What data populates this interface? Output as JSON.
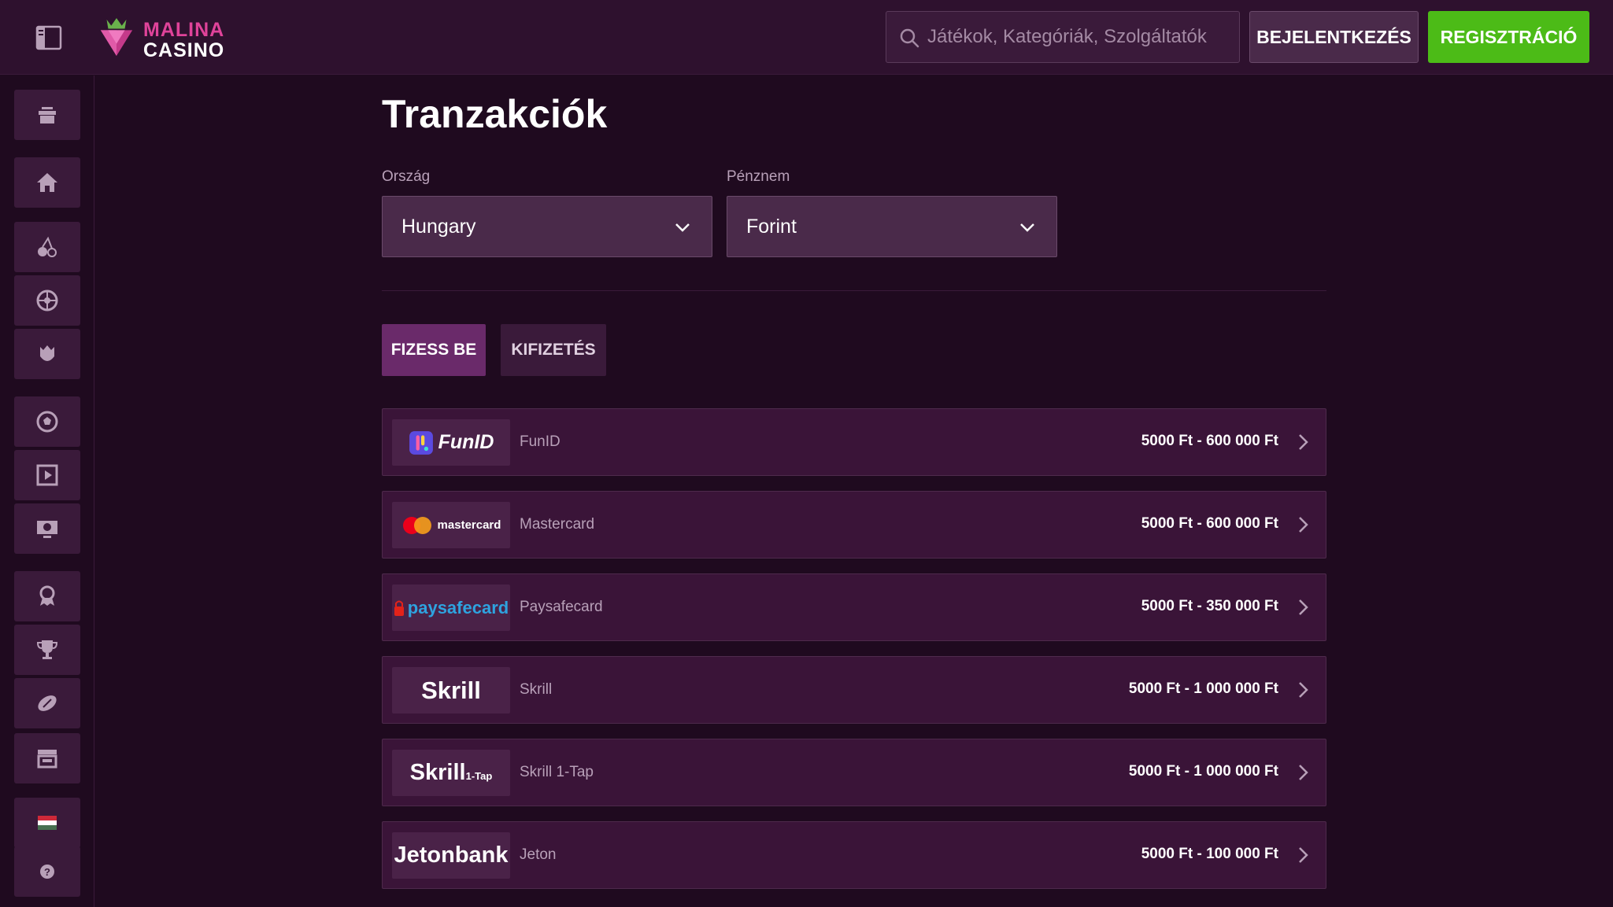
{
  "header": {
    "logo_line1": "MALINA",
    "logo_line2": "CASINO",
    "search_placeholder": "Játékok, Kategóriák, Szolgáltatók",
    "login_label": "BEJELENTKEZÉS",
    "register_label": "REGISZTRÁCIÓ"
  },
  "sidebar": {
    "items": [
      {
        "icon": "gift-icon"
      },
      {
        "icon": "home-icon"
      },
      {
        "icon": "cherries-icon"
      },
      {
        "icon": "roulette-icon"
      },
      {
        "icon": "hands-icon"
      },
      {
        "icon": "soccer-ball-icon"
      },
      {
        "icon": "video-play-icon"
      },
      {
        "icon": "tv-icon"
      },
      {
        "icon": "award-icon"
      },
      {
        "icon": "trophy-icon"
      },
      {
        "icon": "rugby-icon"
      },
      {
        "icon": "shop-icon"
      },
      {
        "icon": "hungary-flag-icon"
      },
      {
        "icon": "help-icon"
      }
    ]
  },
  "main": {
    "title": "Tranzakciók",
    "country": {
      "label": "Ország",
      "value": "Hungary"
    },
    "currency": {
      "label": "Pénznem",
      "value": "Forint"
    },
    "tabs": [
      {
        "label": "FIZESS BE",
        "active": true
      },
      {
        "label": "KIFIZETÉS",
        "active": false
      }
    ],
    "methods": [
      {
        "logo_text": "FunID",
        "name": "FunID",
        "range": "5000 Ft - 600 000 Ft"
      },
      {
        "logo_text": "mastercard",
        "name": "Mastercard",
        "range": "5000 Ft - 600 000 Ft"
      },
      {
        "logo_text": "paysafecard",
        "name": "Paysafecard",
        "range": "5000 Ft - 350 000 Ft"
      },
      {
        "logo_text": "Skrill",
        "name": "Skrill",
        "range": "5000 Ft - 1 000 000 Ft"
      },
      {
        "logo_text": "Skrill",
        "logo_sub": "1-Tap",
        "name": "Skrill 1-Tap",
        "range": "5000 Ft - 1 000 000 Ft"
      },
      {
        "logo_text": "Jetonbank",
        "name": "Jeton",
        "range": "5000 Ft - 100 000 Ft"
      }
    ]
  },
  "colors": {
    "background": "#1f0a1f",
    "header": "#2e112e",
    "register_green": "#4cbb17",
    "active_tab": "#6a2a6a",
    "brand_pink": "#e0439a"
  }
}
